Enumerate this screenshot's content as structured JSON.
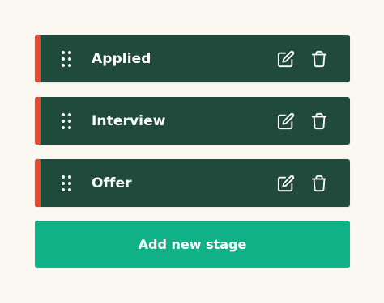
{
  "colors": {
    "background": "#fbf8f1",
    "card": "#1f4a3c",
    "accent": "#e4492f",
    "button": "#10b187",
    "text": "#ffffff"
  },
  "stages": [
    {
      "name": "Applied",
      "handle_icon": "drag-dots-icon",
      "edit_icon": "edit-icon",
      "delete_icon": "trash-icon"
    },
    {
      "name": "Interview",
      "handle_icon": "drag-dots-icon",
      "edit_icon": "edit-icon",
      "delete_icon": "trash-icon"
    },
    {
      "name": "Offer",
      "handle_icon": "drag-dots-icon",
      "edit_icon": "edit-icon",
      "delete_icon": "trash-icon"
    }
  ],
  "add_button": {
    "label": "Add new stage"
  }
}
